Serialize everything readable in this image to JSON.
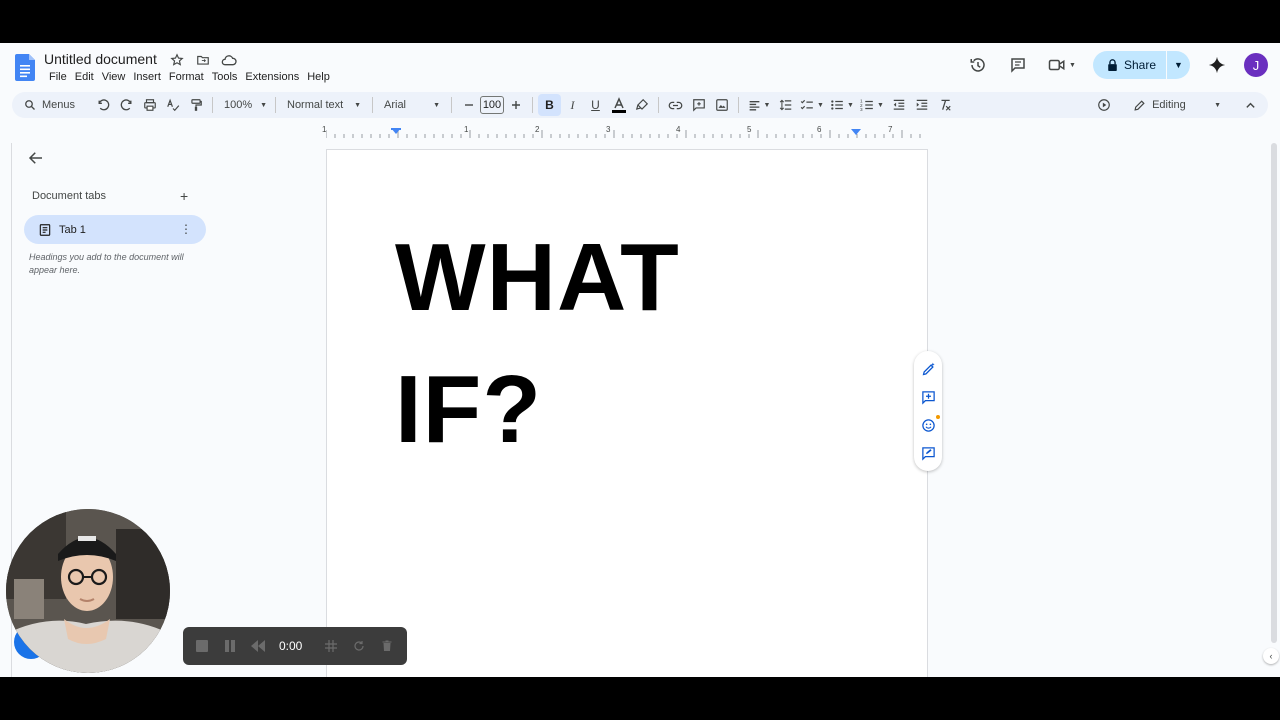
{
  "document": {
    "title": "Untitled document",
    "body_line_1": "WHAT",
    "body_line_2": "IF?"
  },
  "menu": [
    "File",
    "Edit",
    "View",
    "Insert",
    "Format",
    "Tools",
    "Extensions",
    "Help"
  ],
  "header": {
    "share_label": "Share",
    "avatar_initial": "J",
    "share_color": "#c2e7ff",
    "avatar_color": "#6a2fbf"
  },
  "toolbar": {
    "search_label": "Menus",
    "zoom": "100%",
    "style": "Normal text",
    "font": "Arial",
    "font_size": "100",
    "mode": "Editing"
  },
  "ruler": {
    "numbers": [
      "1",
      "1",
      "2",
      "3",
      "4",
      "5",
      "6",
      "7"
    ]
  },
  "sidebar": {
    "heading": "Document tabs",
    "tab_label": "Tab 1",
    "hint": "Headings you add to the document will appear here."
  },
  "recorder": {
    "time": "0:00"
  }
}
